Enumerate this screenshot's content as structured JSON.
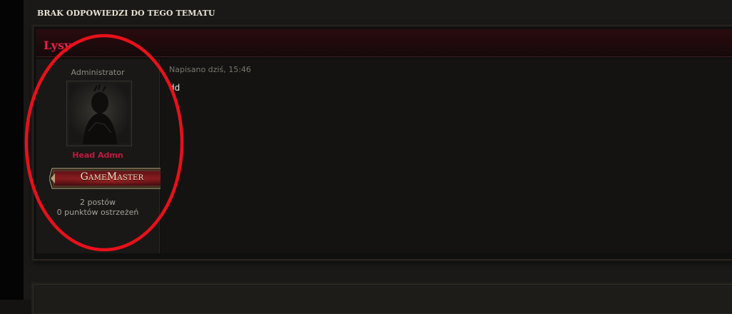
{
  "topic": {
    "header": "BRAK ODPOWIEDZI DO TEGO TEMATU"
  },
  "post": {
    "author_name": "Lysy",
    "group": "Administrator",
    "title": "Head Admn",
    "rank_badge": "GameMaster",
    "posts_count": "2 postów",
    "warning_points": "0 punktów ostrzeżeń",
    "date": "Napisano dziś, 15:46",
    "body": "dd"
  },
  "annotation": {
    "color": "#e8101a"
  },
  "colors": {
    "author_name": "#e3234a",
    "user_title": "#c4173f",
    "background": "#141312"
  },
  "icons": {
    "avatar": "dark-character-avatar",
    "rank": "gamemaster-banner"
  }
}
